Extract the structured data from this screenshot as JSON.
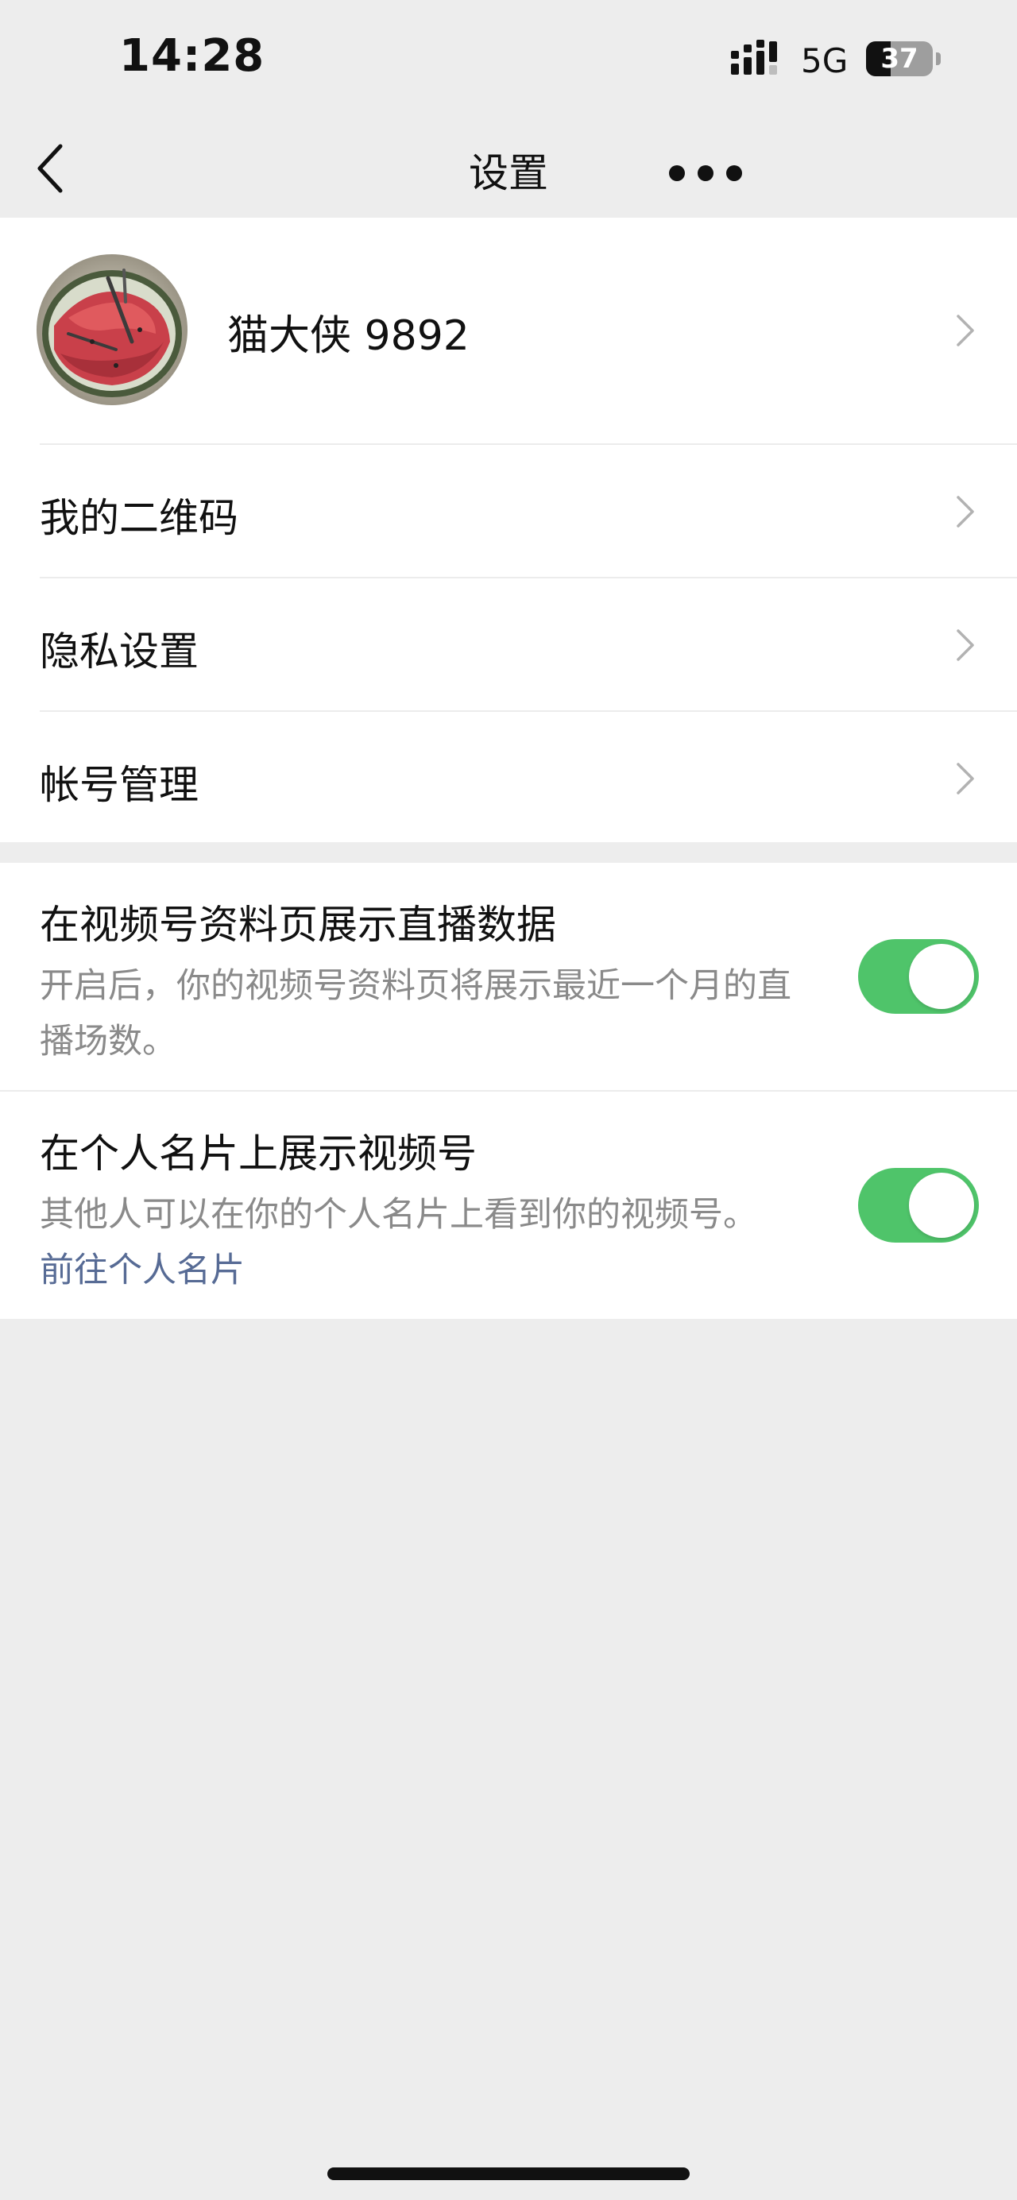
{
  "status_bar": {
    "time": "14:28",
    "network": "5G",
    "battery": "37",
    "battery_level": 0.37
  },
  "nav": {
    "title": "设置",
    "back_icon": "chevron-left-icon",
    "more_icon": "more-dots-icon"
  },
  "profile": {
    "name": "猫大侠 9892",
    "avatar": "watermelon-avatar"
  },
  "menu": [
    {
      "label": "我的二维码"
    },
    {
      "label": "隐私设置"
    },
    {
      "label": "帐号管理"
    }
  ],
  "toggles": [
    {
      "title": "在视频号资料页展示直播数据",
      "desc": "开启后，你的视频号资料页将展示最近一个月的直播场数。",
      "on": true
    },
    {
      "title": "在个人名片上展示视频号",
      "desc": "其他人可以在你的个人名片上看到你的视频号。",
      "link": "前往个人名片",
      "on": true
    }
  ],
  "colors": {
    "background": "#ededed",
    "switch_on": "#4fc46a",
    "link": "#576b95",
    "secondary_text": "#8a8a8a"
  }
}
